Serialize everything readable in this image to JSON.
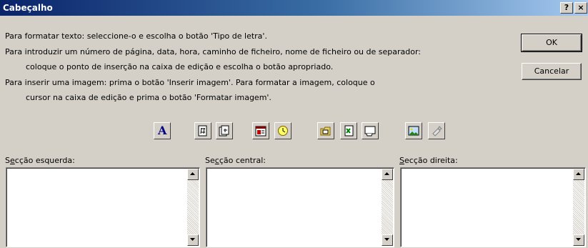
{
  "window": {
    "title": "Cabeçalho",
    "help_label": "?",
    "close_label": "×"
  },
  "instructions": {
    "line1": "Para formatar texto: seleccione-o e escolha o botão 'Tipo de letra'.",
    "line2": "Para introduzir um número de página, data, hora, caminho de ficheiro, nome de ficheiro ou de separador:",
    "line3": "coloque o ponto de inserção na caixa de edição e escolha o botão apropriado.",
    "line4": "Para inserir uma imagem: prima o botão 'Inserir imagem'. Para formatar a imagem, coloque o",
    "line5": "cursor na caixa de edição e prima o botão 'Formatar imagem'."
  },
  "buttons": {
    "ok": "OK",
    "cancel": "Cancelar"
  },
  "toolbar": {
    "font_glyph": "A"
  },
  "sections": {
    "left": {
      "label_prefix": "S",
      "label_accel": "e",
      "label_rest": "cção esquerda:",
      "content": ""
    },
    "center": {
      "label_prefix": "Se",
      "label_accel": "c",
      "label_rest": "ção central:",
      "content": ""
    },
    "right": {
      "label_prefix": "",
      "label_accel": "S",
      "label_rest": "ecção direita:",
      "content": ""
    }
  },
  "colors": {
    "titlebar_start": "#0a246a",
    "titlebar_end": "#a6caf0",
    "dialog_face": "#d4d0c8"
  }
}
